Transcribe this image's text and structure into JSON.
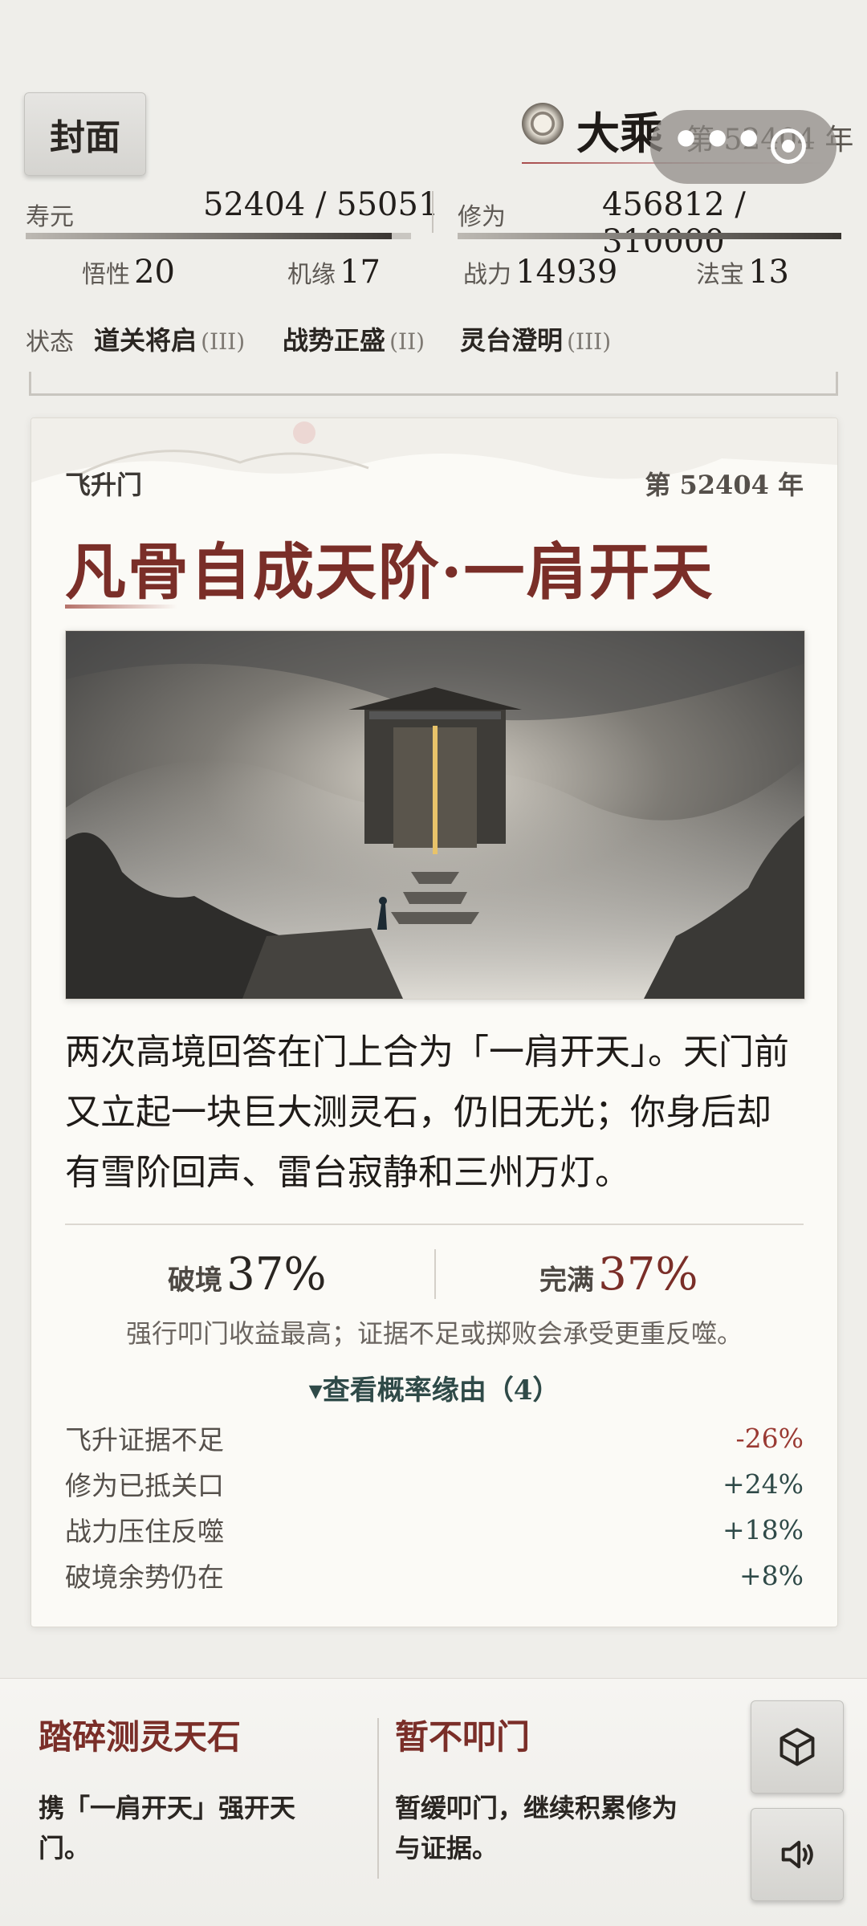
{
  "header": {
    "cover_label": "封面",
    "realm": "大乘",
    "year_text": "第 52404 年",
    "capsule_dots": "•••"
  },
  "stats": {
    "lifespan": {
      "label": "寿元",
      "value": "52404 / 55051",
      "fill_fraction": 0.95
    },
    "cultivation": {
      "label": "修为",
      "value": "456812 / 310000",
      "fill_fraction": 1.0
    },
    "attributes": [
      {
        "label": "悟性",
        "value": "20"
      },
      {
        "label": "机缘",
        "value": "17"
      },
      {
        "label": "战力",
        "value": "14939"
      },
      {
        "label": "法宝",
        "value": "13"
      }
    ]
  },
  "status": {
    "label": "状态",
    "items": [
      {
        "name": "道关将启",
        "level": "(III)"
      },
      {
        "name": "战势正盛",
        "level": "(II)"
      },
      {
        "name": "灵台澄明",
        "level": "(III)"
      }
    ]
  },
  "event": {
    "sect": "飞升门",
    "year": "第 52404 年",
    "title": "凡骨自成天阶·一肩开天",
    "description_lines": [
      "两次高境回答在门上合为「一肩开天」。天门前",
      "又立起一块巨大测灵石，仍旧无光；你身后却",
      "有雪阶回声、雷台寂静和三州万灯。"
    ],
    "breakthrough": {
      "label": "破境",
      "value": "37%"
    },
    "perfection": {
      "label": "完满",
      "value": "37%"
    },
    "hint": "强行叩门收益最高；证据不足或掷败会承受更重反噬。",
    "reasons_toggle": "▾查看概率缘由（4）",
    "reasons": [
      {
        "label": "飞升证据不足",
        "value": "-26%"
      },
      {
        "label": "修为已抵关口",
        "value": "+24%"
      },
      {
        "label": "战力压住反噬",
        "value": "+18%"
      },
      {
        "label": "破境余势仍在",
        "value": "+8%"
      }
    ]
  },
  "choices": [
    {
      "title": "踏碎测灵天石",
      "desc_lines": [
        "携「一肩开天」强开天",
        "门。"
      ]
    },
    {
      "title": "暂不叩门",
      "desc_lines": [
        "暂缓叩门，继续积累修为",
        "与证据。"
      ]
    }
  ],
  "side_buttons": {
    "top_icon": "cube-icon",
    "bottom_icon": "speaker-icon"
  },
  "colors": {
    "accent_red": "#7a2e28",
    "accent_teal": "#2f4a48",
    "negative": "#9a3a33"
  }
}
